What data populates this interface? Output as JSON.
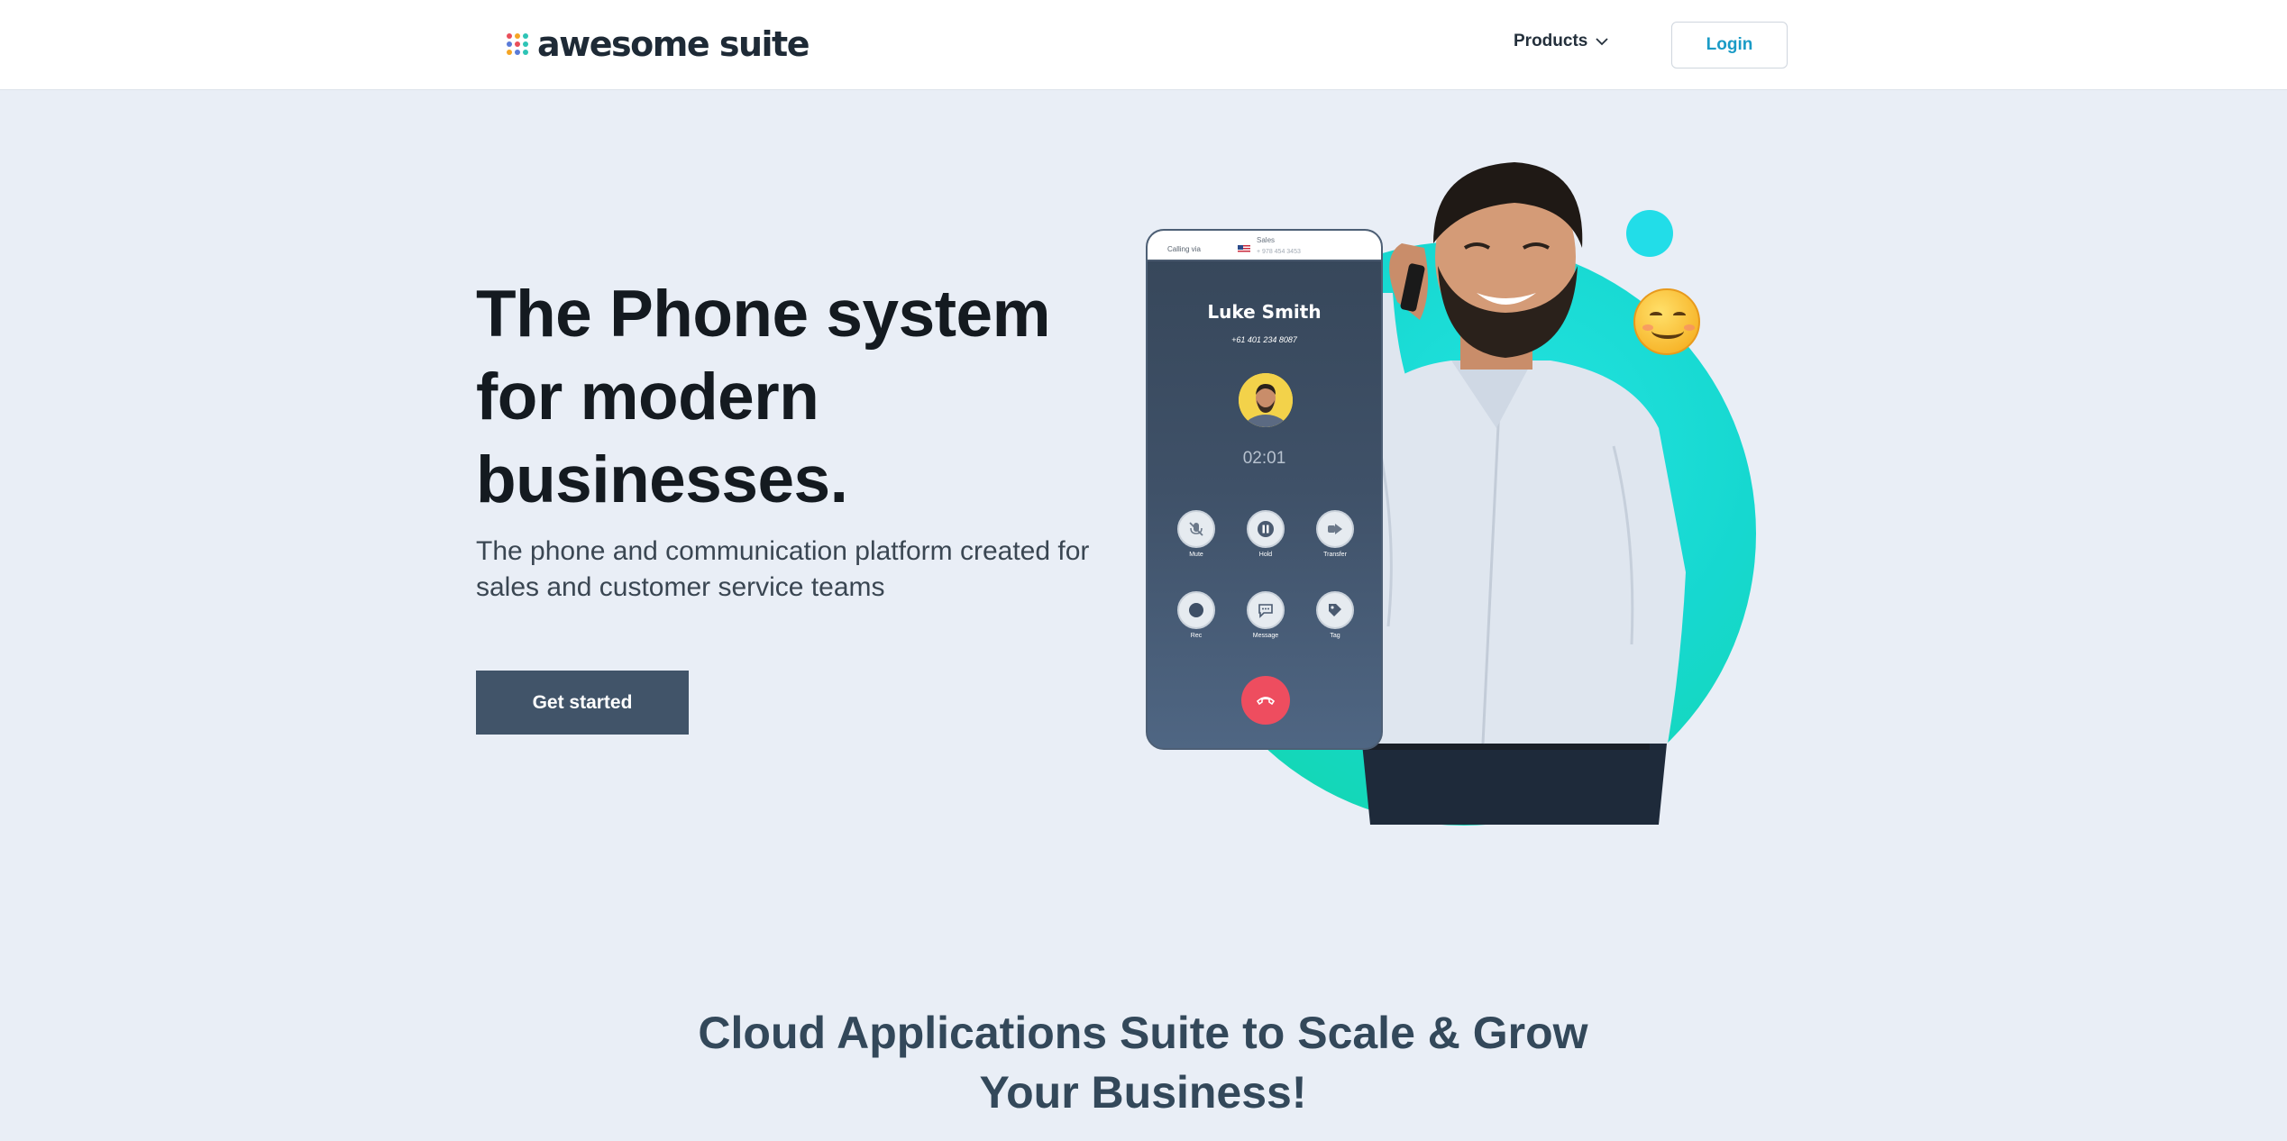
{
  "header": {
    "logo_text": "awesome suite",
    "logo_dot_colors": [
      "#e94f5a",
      "#f5a524",
      "#2ec4b6",
      "#5a7bd8",
      "#e94f5a",
      "#2ec4b6",
      "#f5a524",
      "#5a7bd8",
      "#2ec4b6"
    ],
    "nav": {
      "products_label": "Products",
      "products_icon": "chevron-down-icon"
    },
    "login_label": "Login"
  },
  "hero": {
    "title_line1": "The Phone system",
    "title_line2": "for modern",
    "title_line3": "businesses.",
    "subtitle": "The phone and communication platform created for sales and customer service teams",
    "cta_label": "Get started"
  },
  "phone": {
    "calling_via": "Calling via",
    "line_name": "Sales",
    "line_number": "+ 978 454 3453",
    "caller_name": "Luke Smith",
    "caller_number": "+61 401 234 8087",
    "timer": "02:01",
    "controls": [
      {
        "label": "Mute",
        "icon": "mic-off-icon"
      },
      {
        "label": "Hold",
        "icon": "pause-icon"
      },
      {
        "label": "Transfer",
        "icon": "transfer-icon"
      },
      {
        "label": "Rec",
        "icon": "record-icon"
      },
      {
        "label": "Message",
        "icon": "message-icon"
      },
      {
        "label": "Tag",
        "icon": "tag-icon"
      }
    ],
    "hangup_icon": "hang-up-icon"
  },
  "section": {
    "title_line1": "Cloud Applications Suite to Scale & Grow",
    "title_line2": "Your Business!"
  },
  "colors": {
    "page_bg": "#e9eef6",
    "accent_teal": "#16d8d0",
    "cta_bg": "#415469",
    "link_blue": "#1a9bc6",
    "hangup_red": "#ee4d5f"
  }
}
